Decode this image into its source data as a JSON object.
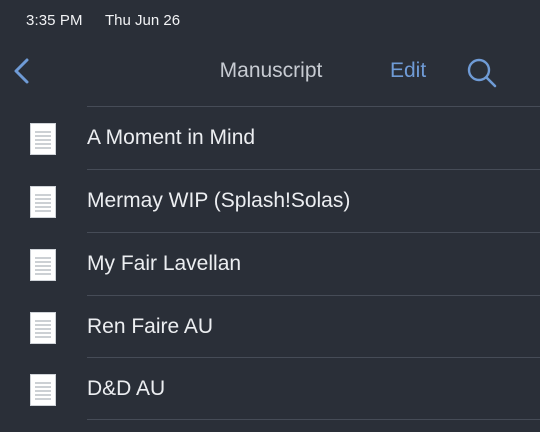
{
  "status_bar": {
    "time": "3:35 PM",
    "date": "Thu Jun 26"
  },
  "nav": {
    "back_icon": "chevron-left-icon",
    "title": "Manuscript",
    "edit_label": "Edit",
    "search_icon": "search-icon"
  },
  "colors": {
    "background": "#2a2f38",
    "accent": "#6f9bd6",
    "divider": "#464c57",
    "title": "#c7cbd2",
    "text": "#eceef1"
  },
  "documents": [
    {
      "label": "A Moment in Mind",
      "icon": "document-icon"
    },
    {
      "label": "Mermay WIP (Splash!Solas)",
      "icon": "document-icon"
    },
    {
      "label": "My Fair Lavellan",
      "icon": "document-icon"
    },
    {
      "label": "Ren Faire AU",
      "icon": "document-icon"
    },
    {
      "label": "D&D AU",
      "icon": "document-icon"
    }
  ]
}
